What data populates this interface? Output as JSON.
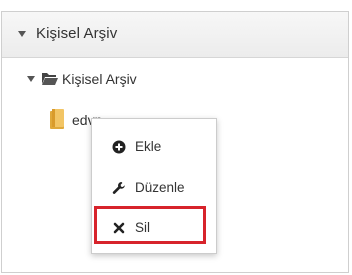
{
  "panel": {
    "title": "Kişisel Arşiv"
  },
  "tree": {
    "root_label": "Kişisel Arşiv",
    "child_label": "edvp"
  },
  "context_menu": {
    "items": [
      {
        "label": "Ekle",
        "icon": "plus-circle-icon"
      },
      {
        "label": "Düzenle",
        "icon": "wrench-icon"
      },
      {
        "label": "Sil",
        "icon": "x-icon"
      }
    ]
  },
  "colors": {
    "highlight": "#d7232b",
    "folder": "#e8b54a",
    "text": "#333333"
  }
}
